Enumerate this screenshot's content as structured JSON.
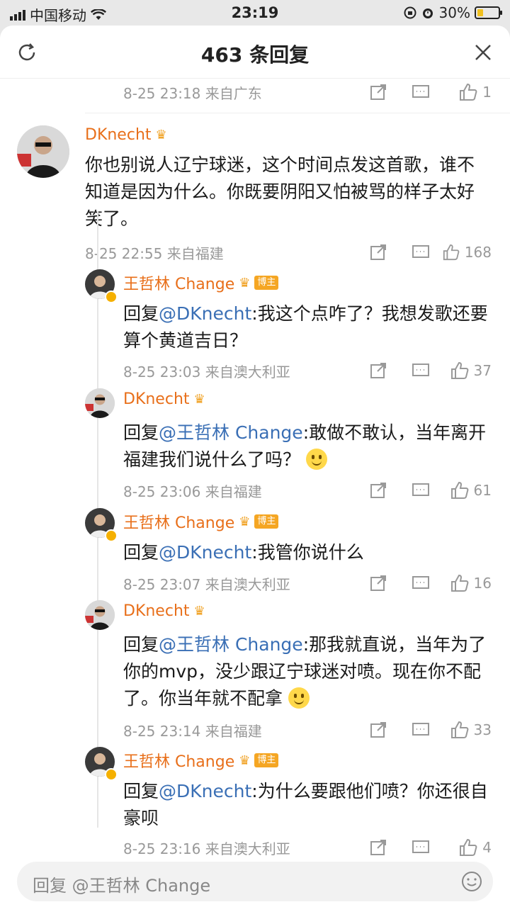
{
  "status": {
    "carrier": "中国移动",
    "time": "23:19",
    "battery": "30%",
    "battery_level": 0.3
  },
  "header": {
    "title": "463 条回复"
  },
  "prev_meta": {
    "text": "8-25 23:18 来自广东",
    "likes": "1"
  },
  "root": {
    "user": "DKnecht",
    "text": "你也别说人辽宁球迷，这个时间点发这首歌，谁不知道是因为什么。你既要阴阳又怕被骂的样子太好笑了。",
    "meta": "8-25 22:55 来自福建",
    "likes": "168"
  },
  "replies": [
    {
      "user": "王哲林 Change",
      "badge": "博主",
      "prefix": "回复",
      "mention": "@DKnecht",
      "text": ":我这个点咋了？我想发歌还要算个黄道吉日？",
      "meta": "8-25 23:03 来自澳大利亚",
      "likes": "37"
    },
    {
      "user": "DKnecht",
      "badge": "",
      "prefix": "回复",
      "mention": "@王哲林 Change",
      "text": ":敢做不敢认，当年离开福建我们说什么了吗？",
      "meta": "8-25 23:06 来自福建",
      "likes": "61"
    },
    {
      "user": "王哲林 Change",
      "badge": "博主",
      "prefix": "回复",
      "mention": "@DKnecht",
      "text": ":我管你说什么",
      "meta": "8-25 23:07 来自澳大利亚",
      "likes": "16"
    },
    {
      "user": "DKnecht",
      "badge": "",
      "prefix": "回复",
      "mention": "@王哲林 Change",
      "text": ":那我就直说，当年为了你的mvp，没少跟辽宁球迷对喷。现在你不配了。你当年就不配拿",
      "meta": "8-25 23:14 来自福建",
      "likes": "33"
    },
    {
      "user": "王哲林 Change",
      "badge": "博主",
      "prefix": "回复",
      "mention": "@DKnecht",
      "text": ":为什么要跟他们喷？你还很自豪呗",
      "meta": "8-25 23:16 来自澳大利亚",
      "likes": "4"
    }
  ],
  "reply_bar": {
    "placeholder": "回复 @王哲林 Change"
  },
  "icons": [
    "signal-icon",
    "wifi-icon",
    "lock-icon",
    "alarm-icon",
    "battery-icon",
    "refresh-icon",
    "close-icon",
    "share-icon",
    "comment-icon",
    "like-icon",
    "smile-emoji-icon",
    "emoji-icon"
  ]
}
